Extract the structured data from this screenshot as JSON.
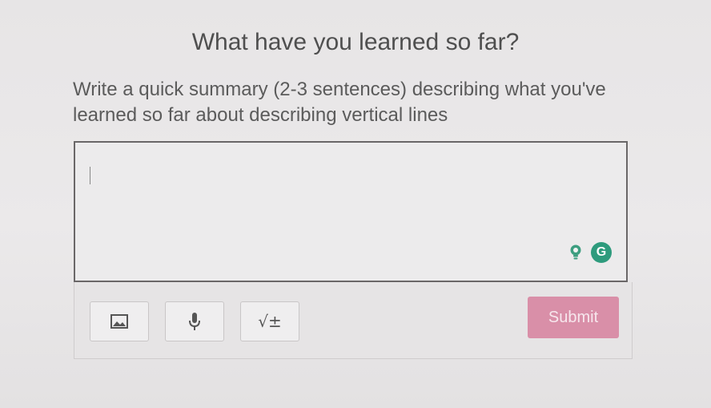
{
  "heading": "What have you learned so far?",
  "prompt": "Write a quick summary (2-3 sentences) describing what you've learned so far about describing vertical lines",
  "editor": {
    "value": "",
    "hint_icon": "lightbulb-icon",
    "grammarly_icon": "grammarly-icon",
    "grammarly_glyph": "G"
  },
  "toolbar": {
    "image_icon": "image-icon",
    "mic_icon": "microphone-icon",
    "math_label": "√±",
    "submit_label": "Submit",
    "submit_color": "#d98fa8"
  }
}
